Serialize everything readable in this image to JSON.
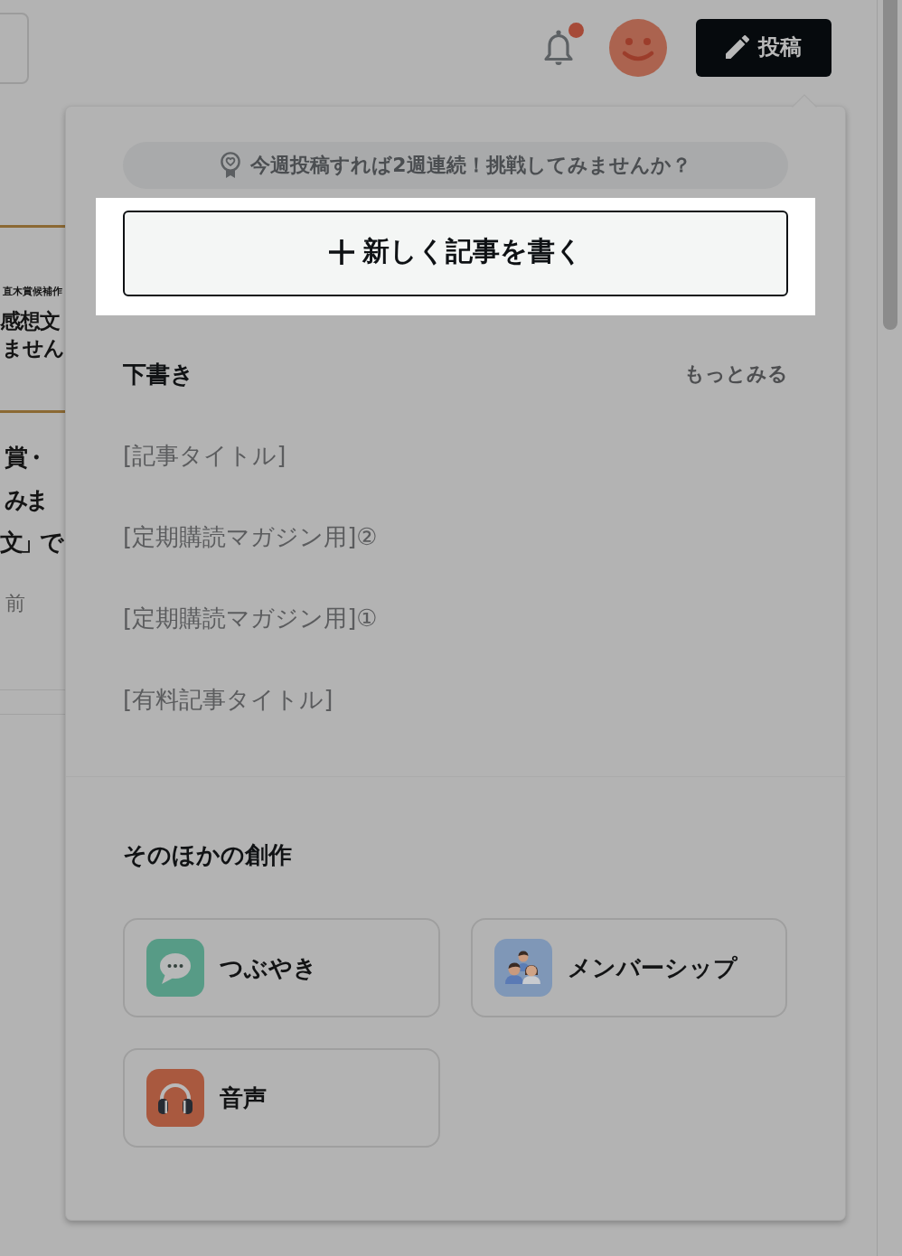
{
  "header": {
    "notifications_unread": true,
    "post_button": "投稿"
  },
  "background_article": {
    "banner_caption": "直木賞候補作",
    "banner_title_lines": [
      "感想文",
      "ません"
    ],
    "title_lines": [
      "賞・",
      "みま",
      "文」で"
    ],
    "meta": "前"
  },
  "popover": {
    "streak_banner": "今週投稿すれば2週連続！挑戦してみませんか？",
    "new_article_button": {
      "label": "新しく記事を書く",
      "highlighted": true
    },
    "drafts": {
      "title": "下書き",
      "more_link": "もっとみる",
      "items": [
        "[記事タイトル]",
        "[定期購読マガジン用]②",
        "[定期購読マガジン用]①",
        "[有料記事タイトル]"
      ]
    },
    "other_creations": {
      "title": "そのほかの創作",
      "options": [
        {
          "kind": "tweet",
          "label": "つぶやき"
        },
        {
          "kind": "membership",
          "label": "メンバーシップ"
        },
        {
          "kind": "audio",
          "label": "音声"
        }
      ]
    }
  }
}
